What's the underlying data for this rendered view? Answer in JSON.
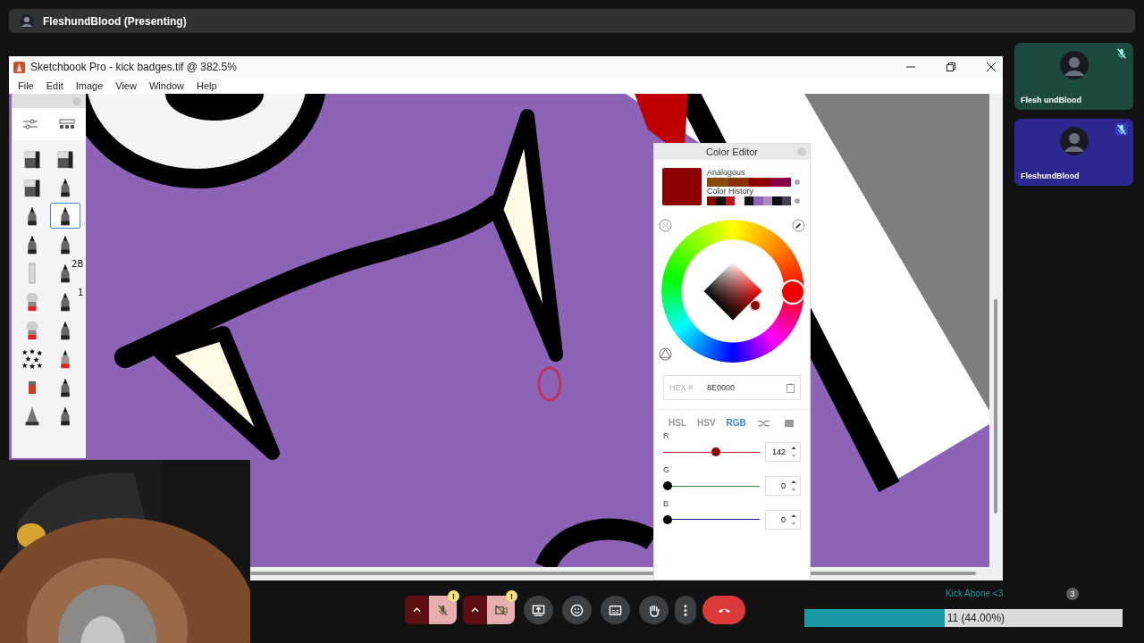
{
  "presenter_bar": {
    "name": "FleshundBlood (Presenting)"
  },
  "window": {
    "title": "Sketchbook Pro - kick badges.tif @ 382.5%",
    "menu": [
      "File",
      "Edit",
      "Image",
      "View",
      "Window",
      "Help"
    ]
  },
  "tool_palette": {
    "tools": [
      {
        "selected": false
      },
      {
        "selected": false
      },
      {
        "selected": false
      },
      {
        "selected": false
      },
      {
        "selected": false
      },
      {
        "selected": true
      },
      {
        "selected": false
      },
      {
        "selected": false
      },
      {
        "selected": false
      },
      {
        "selected": false,
        "label": "2B"
      },
      {
        "selected": false
      },
      {
        "selected": false,
        "label": "1"
      },
      {
        "selected": false
      },
      {
        "selected": false
      },
      {
        "selected": false
      },
      {
        "selected": false
      },
      {
        "selected": false
      },
      {
        "selected": false
      },
      {
        "selected": false
      },
      {
        "selected": false
      }
    ]
  },
  "color_editor": {
    "title": "Color Editor",
    "swatch": {
      "color": "#8e0000"
    },
    "analogous": {
      "label": "Analogous",
      "colors": [
        {
          "color": "#8b4c0a"
        },
        {
          "color": "#8a3005"
        },
        {
          "color": "#8e0000"
        },
        {
          "color": "#8a0045"
        }
      ]
    },
    "history": {
      "label": "Color History",
      "colors": [
        {
          "color": "#8e0000"
        },
        {
          "color": "#111111"
        },
        {
          "color": "#c0101a"
        },
        {
          "color": "#f0f0f0"
        },
        {
          "color": "#111111"
        },
        {
          "color": "#8e62b8"
        },
        {
          "color": "#a88cc0"
        },
        {
          "color": "#111111"
        },
        {
          "color": "#444050"
        }
      ]
    },
    "hex": {
      "label": "HEX #",
      "value": "8E0000"
    },
    "modes": [
      {
        "label": "HSL",
        "selected": false
      },
      {
        "label": "HSV",
        "selected": false
      },
      {
        "label": "RGB",
        "selected": true
      }
    ],
    "channels": [
      {
        "name": "R",
        "value": "142",
        "level": 0.55,
        "color": "#c0142a"
      },
      {
        "name": "G",
        "value": "0",
        "level": 0,
        "color": "#2e8b3a"
      },
      {
        "name": "B",
        "value": "0",
        "level": 0,
        "color": "#1a1aa0"
      }
    ]
  },
  "participants": [
    {
      "name": "Flesh undBlood",
      "muted": true,
      "color": "#1c4a3f"
    },
    {
      "name": "FleshundBlood",
      "muted": true,
      "color": "#2b2890"
    }
  ],
  "call_controls": [
    {
      "kind": "mic",
      "on": false,
      "badge": "!"
    },
    {
      "kind": "camera",
      "on": false,
      "badge": "!"
    },
    {
      "kind": "present"
    },
    {
      "kind": "emoji"
    },
    {
      "kind": "captions"
    },
    {
      "kind": "hand"
    },
    {
      "kind": "more"
    },
    {
      "kind": "end"
    }
  ],
  "poll": {
    "label": "Kick Abone <3",
    "reading": "11 (44.00%)",
    "level": 0.44
  },
  "people_badge": "3"
}
